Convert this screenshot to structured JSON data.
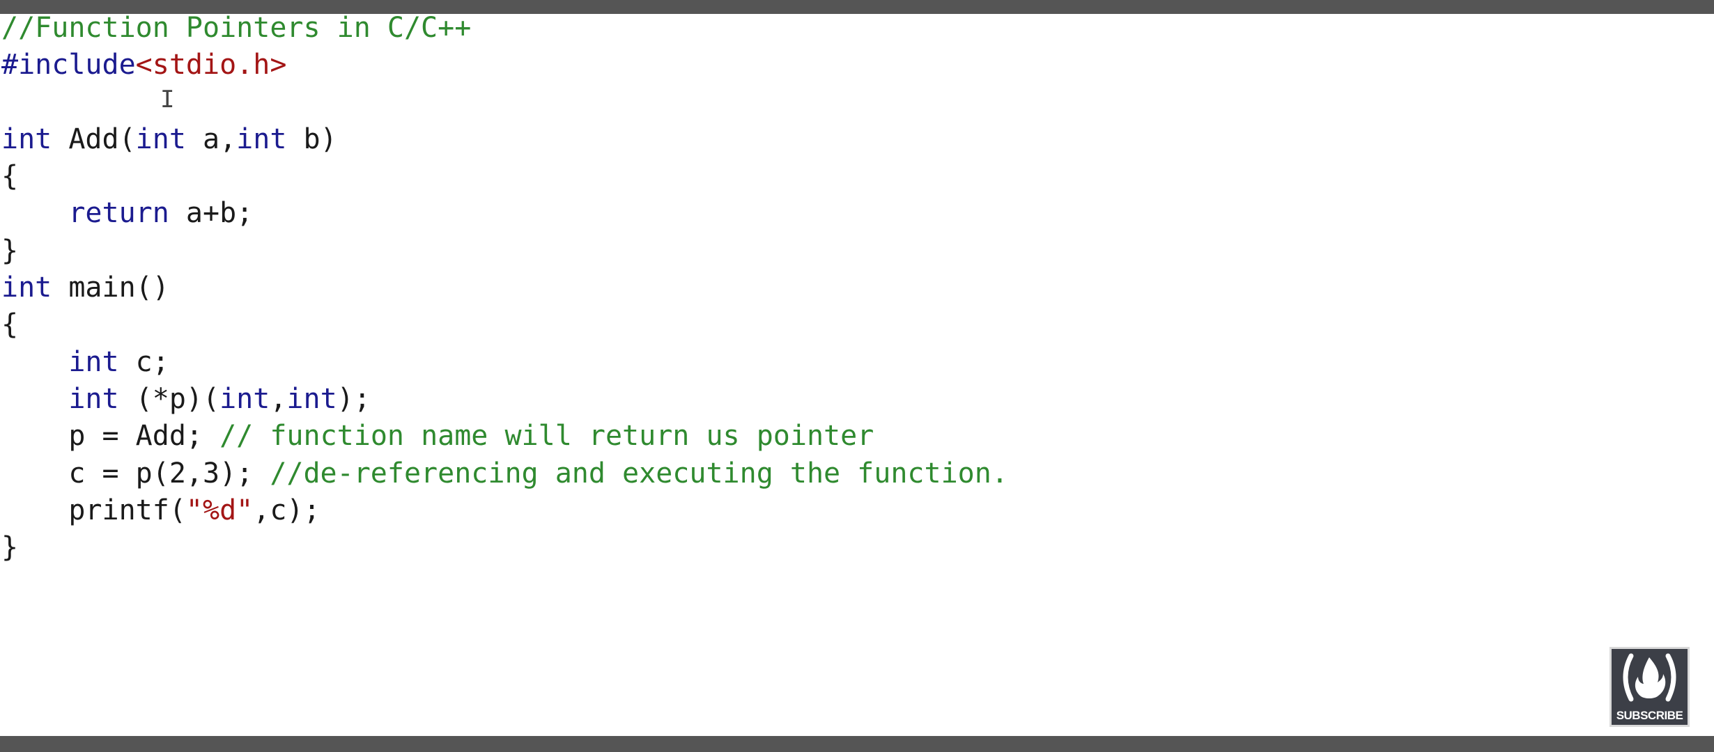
{
  "colors": {
    "keyword": "#1b1b8f",
    "comment": "#2f8a2f",
    "string": "#a31515",
    "identifier": "#1a1a1a",
    "frame_bar": "#555555",
    "badge_bg": "#3c3f47"
  },
  "code_lines": [
    [
      {
        "t": "//Function Pointers in C/C++",
        "c": "cm"
      }
    ],
    [
      {
        "t": "#include",
        "c": "pp"
      },
      {
        "t": "<stdio.h>",
        "c": "str"
      }
    ],
    [
      {
        "t": "",
        "c": "id"
      }
    ],
    [
      {
        "t": "int",
        "c": "kw"
      },
      {
        "t": " Add(",
        "c": "id"
      },
      {
        "t": "int",
        "c": "kw"
      },
      {
        "t": " a,",
        "c": "id"
      },
      {
        "t": "int",
        "c": "kw"
      },
      {
        "t": " b)",
        "c": "id"
      }
    ],
    [
      {
        "t": "{",
        "c": "id"
      }
    ],
    [
      {
        "t": "    ",
        "c": "id"
      },
      {
        "t": "return",
        "c": "kw"
      },
      {
        "t": " a+b;",
        "c": "id"
      }
    ],
    [
      {
        "t": "}",
        "c": "id"
      }
    ],
    [
      {
        "t": "int",
        "c": "kw"
      },
      {
        "t": " main()",
        "c": "id"
      }
    ],
    [
      {
        "t": "{",
        "c": "id"
      }
    ],
    [
      {
        "t": "    ",
        "c": "id"
      },
      {
        "t": "int",
        "c": "kw"
      },
      {
        "t": " c;",
        "c": "id"
      }
    ],
    [
      {
        "t": "    ",
        "c": "id"
      },
      {
        "t": "int",
        "c": "kw"
      },
      {
        "t": " (*p)(",
        "c": "id"
      },
      {
        "t": "int",
        "c": "kw"
      },
      {
        "t": ",",
        "c": "id"
      },
      {
        "t": "int",
        "c": "kw"
      },
      {
        "t": ");",
        "c": "id"
      }
    ],
    [
      {
        "t": "    p = Add; ",
        "c": "id"
      },
      {
        "t": "// function name will return us pointer",
        "c": "cm"
      }
    ],
    [
      {
        "t": "    c = p(2,3); ",
        "c": "id"
      },
      {
        "t": "//de-referencing and executing the function.",
        "c": "cm"
      }
    ],
    [
      {
        "t": "    printf(",
        "c": "id"
      },
      {
        "t": "\"%d\"",
        "c": "str"
      },
      {
        "t": ",c);",
        "c": "id"
      }
    ],
    [
      {
        "t": "}",
        "c": "id"
      }
    ]
  ],
  "cursor_glyph": "I",
  "badge": {
    "label": "SUBSCRIBE",
    "icon": "freecodecamp-flame-icon"
  }
}
